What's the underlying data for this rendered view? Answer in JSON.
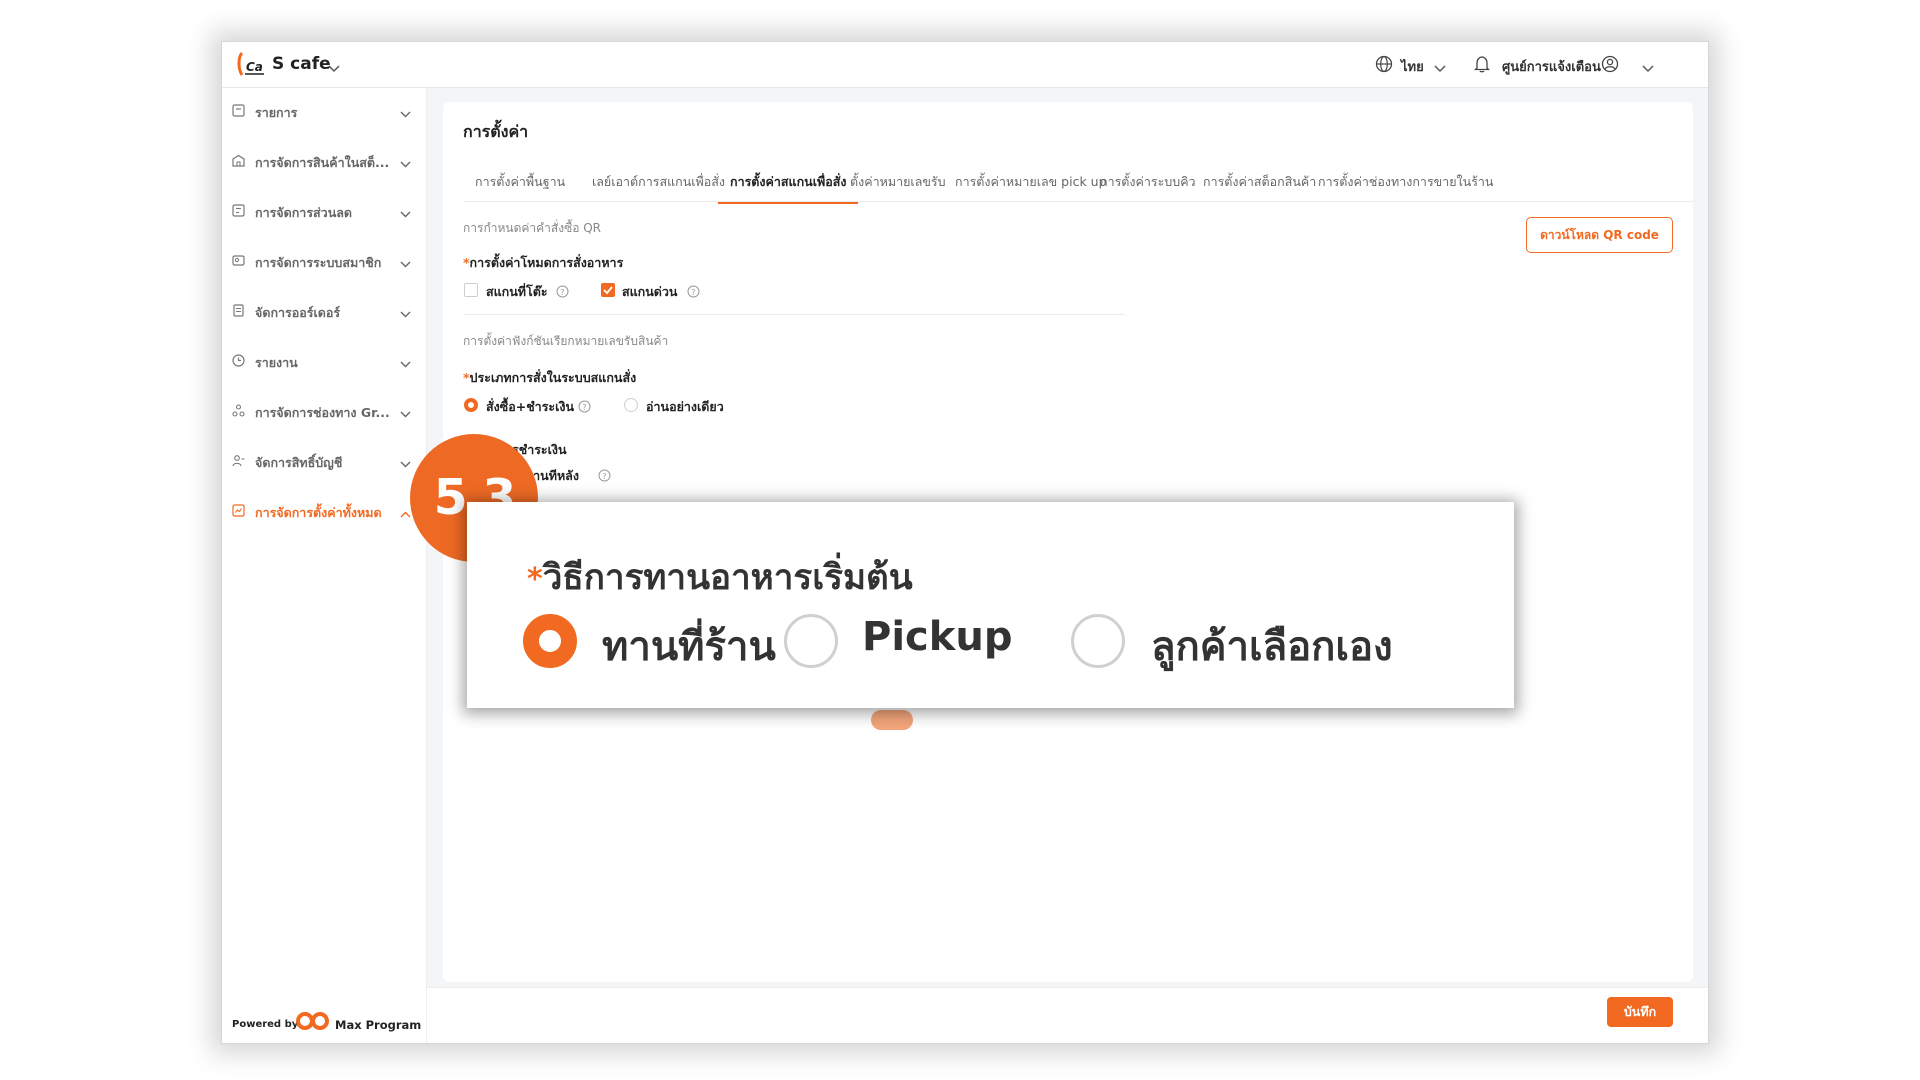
{
  "header": {
    "brand": "S cafe",
    "language": "ไทย",
    "notifications": "ศูนย์การแจ้งเตือน"
  },
  "sidebar": {
    "items": [
      {
        "label": "รายการ",
        "icon": "list-icon"
      },
      {
        "label": "การจัดการสินค้าในสต็...",
        "icon": "store-icon"
      },
      {
        "label": "การจัดการส่วนลด",
        "icon": "discount-icon"
      },
      {
        "label": "การจัดการระบบสมาชิก",
        "icon": "member-icon"
      },
      {
        "label": "จัดการออร์เดอร์",
        "icon": "order-icon"
      },
      {
        "label": "รายงาน",
        "icon": "report-icon"
      },
      {
        "label": "การจัดการช่องทาง Gr...",
        "icon": "channel-icon"
      },
      {
        "label": "จัดการสิทธิ์บัญชี",
        "icon": "account-icon"
      },
      {
        "label": "การจัดการตั้งค่าทั้งหมด",
        "icon": "settings-icon"
      }
    ],
    "active_index": 8,
    "powered_by": "Powered by",
    "powered_brand": "Max Program"
  },
  "page": {
    "title": "การตั้งค่า",
    "tabs": [
      "การตั้งค่าพื้นฐาน",
      "เลย์เอาต์การสแกนเพื่อสั่ง",
      "การตั้งค่าสแกนเพื่อสั่ง",
      "ตั้งค่าหมายเลขรับ",
      "การตั้งค่าหมายเลข pick up",
      "การตั้งค่าระบบคิว",
      "การตั้งค่าสต็อกสินค้า",
      "การตั้งค่าช่องทางการขายในร้าน"
    ],
    "active_tab": 2,
    "download_button": "ดาวน์โหลด QR code",
    "save_button": "บันทึก"
  },
  "form": {
    "section1": "การกำหนดค่าคำสั่งซื้อ QR",
    "mode_label": "การตั้งค่าโหมดการสั่งอาหาร",
    "mode_options": [
      {
        "label": "สแกนที่โต๊ะ",
        "checked": false
      },
      {
        "label": "สแกนด่วน",
        "checked": true
      }
    ],
    "section2": "การตั้งค่าฟังก์ชันเรียกหมายเลขรับสินค้า",
    "type_label": "ประเภทการสั่งในระบบสแกนสั่ง",
    "type_options": [
      {
        "label": "สั่งซื้อ+ชำระเงิน",
        "selected": true
      },
      {
        "label": "อ่านอย่างเดียว",
        "selected": false
      }
    ],
    "partial_payment": "รชำระเงิน",
    "partial_later": "น ทานทีหลัง"
  },
  "zoom": {
    "step": "5.3",
    "title": "วิธีการทานอาหารเริ่มต้น",
    "options": [
      {
        "label": "ทานที่ร้าน",
        "selected": true
      },
      {
        "label": "Pickup",
        "selected": false
      },
      {
        "label": "ลูกค้าเลือกเอง",
        "selected": false
      }
    ]
  },
  "colors": {
    "accent": "#f26a21",
    "badge": "#ee6a24"
  }
}
